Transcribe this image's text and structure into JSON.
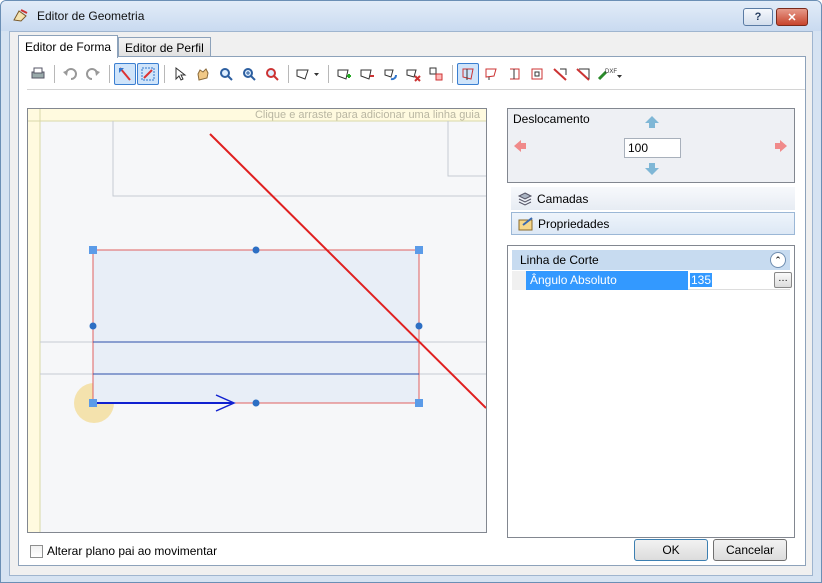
{
  "window": {
    "title": "Editor de Geometria",
    "help_label": "?",
    "close_label": "✕"
  },
  "tabs": [
    {
      "label": "Editor de Forma",
      "active": true
    },
    {
      "label": "Editor de Perfil",
      "active": false
    }
  ],
  "toolbar": {
    "tools": [
      "print-icon",
      "undo-icon",
      "redo-icon",
      "select-shape-icon",
      "select-edit-icon",
      "pointer-icon",
      "pan-icon",
      "zoom-icon",
      "zoom-in-icon",
      "zoom-out-icon",
      "shape-dropdown-icon",
      "add-point-icon",
      "remove-point-icon",
      "rotate-icon",
      "delete-shape-icon",
      "move-icon",
      "cut-tool-1-icon",
      "cut-tool-2-icon",
      "cut-tool-3-icon",
      "cut-tool-4-icon",
      "corner-cut-icon",
      "corner-cut-2-icon",
      "dxf-export-icon"
    ]
  },
  "canvas": {
    "guide_hint": "Clique e arraste para adicionar uma linha guia"
  },
  "deslocamento": {
    "label": "Deslocamento",
    "value": "100"
  },
  "panels": {
    "camadas": "Camadas",
    "propriedades": "Propriedades"
  },
  "properties": {
    "category": "Linha de Corte",
    "rows": [
      {
        "name": "Ângulo Absoluto",
        "value": "135"
      }
    ]
  },
  "footer": {
    "checkbox_label": "Alterar plano pai ao movimentar",
    "ok": "OK",
    "cancel": "Cancelar"
  }
}
